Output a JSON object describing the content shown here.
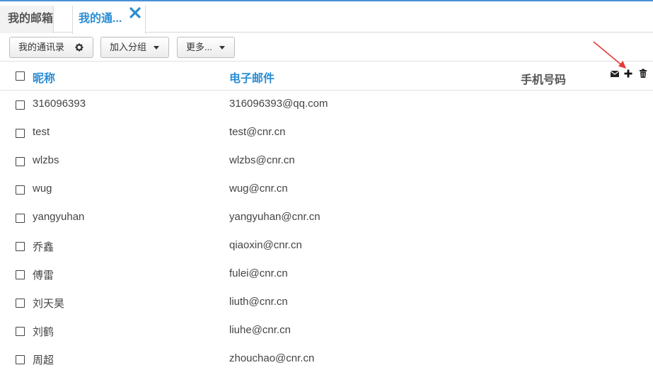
{
  "tabs": [
    {
      "label": "我的邮箱"
    },
    {
      "label": "我的通..."
    }
  ],
  "toolbar": {
    "contacts_label": "我的通讯录",
    "group_label": "加入分组",
    "more_label": "更多..."
  },
  "header": {
    "nickname": "昵称",
    "email": "电子邮件",
    "phone": "手机号码"
  },
  "colors": {
    "accent": "#2a8dd4",
    "arrow": "#e53935"
  },
  "contacts": [
    {
      "nickname": "316096393",
      "email": "316096393@qq.com"
    },
    {
      "nickname": "test",
      "email": "test@cnr.cn"
    },
    {
      "nickname": "wlzbs",
      "email": "wlzbs@cnr.cn"
    },
    {
      "nickname": "wug",
      "email": "wug@cnr.cn"
    },
    {
      "nickname": "yangyuhan",
      "email": "yangyuhan@cnr.cn"
    },
    {
      "nickname": "乔鑫",
      "email": "qiaoxin@cnr.cn"
    },
    {
      "nickname": "傅雷",
      "email": "fulei@cnr.cn"
    },
    {
      "nickname": "刘天昊",
      "email": "liuth@cnr.cn"
    },
    {
      "nickname": "刘鹤",
      "email": "liuhe@cnr.cn"
    },
    {
      "nickname": "周超",
      "email": "zhouchao@cnr.cn"
    }
  ]
}
